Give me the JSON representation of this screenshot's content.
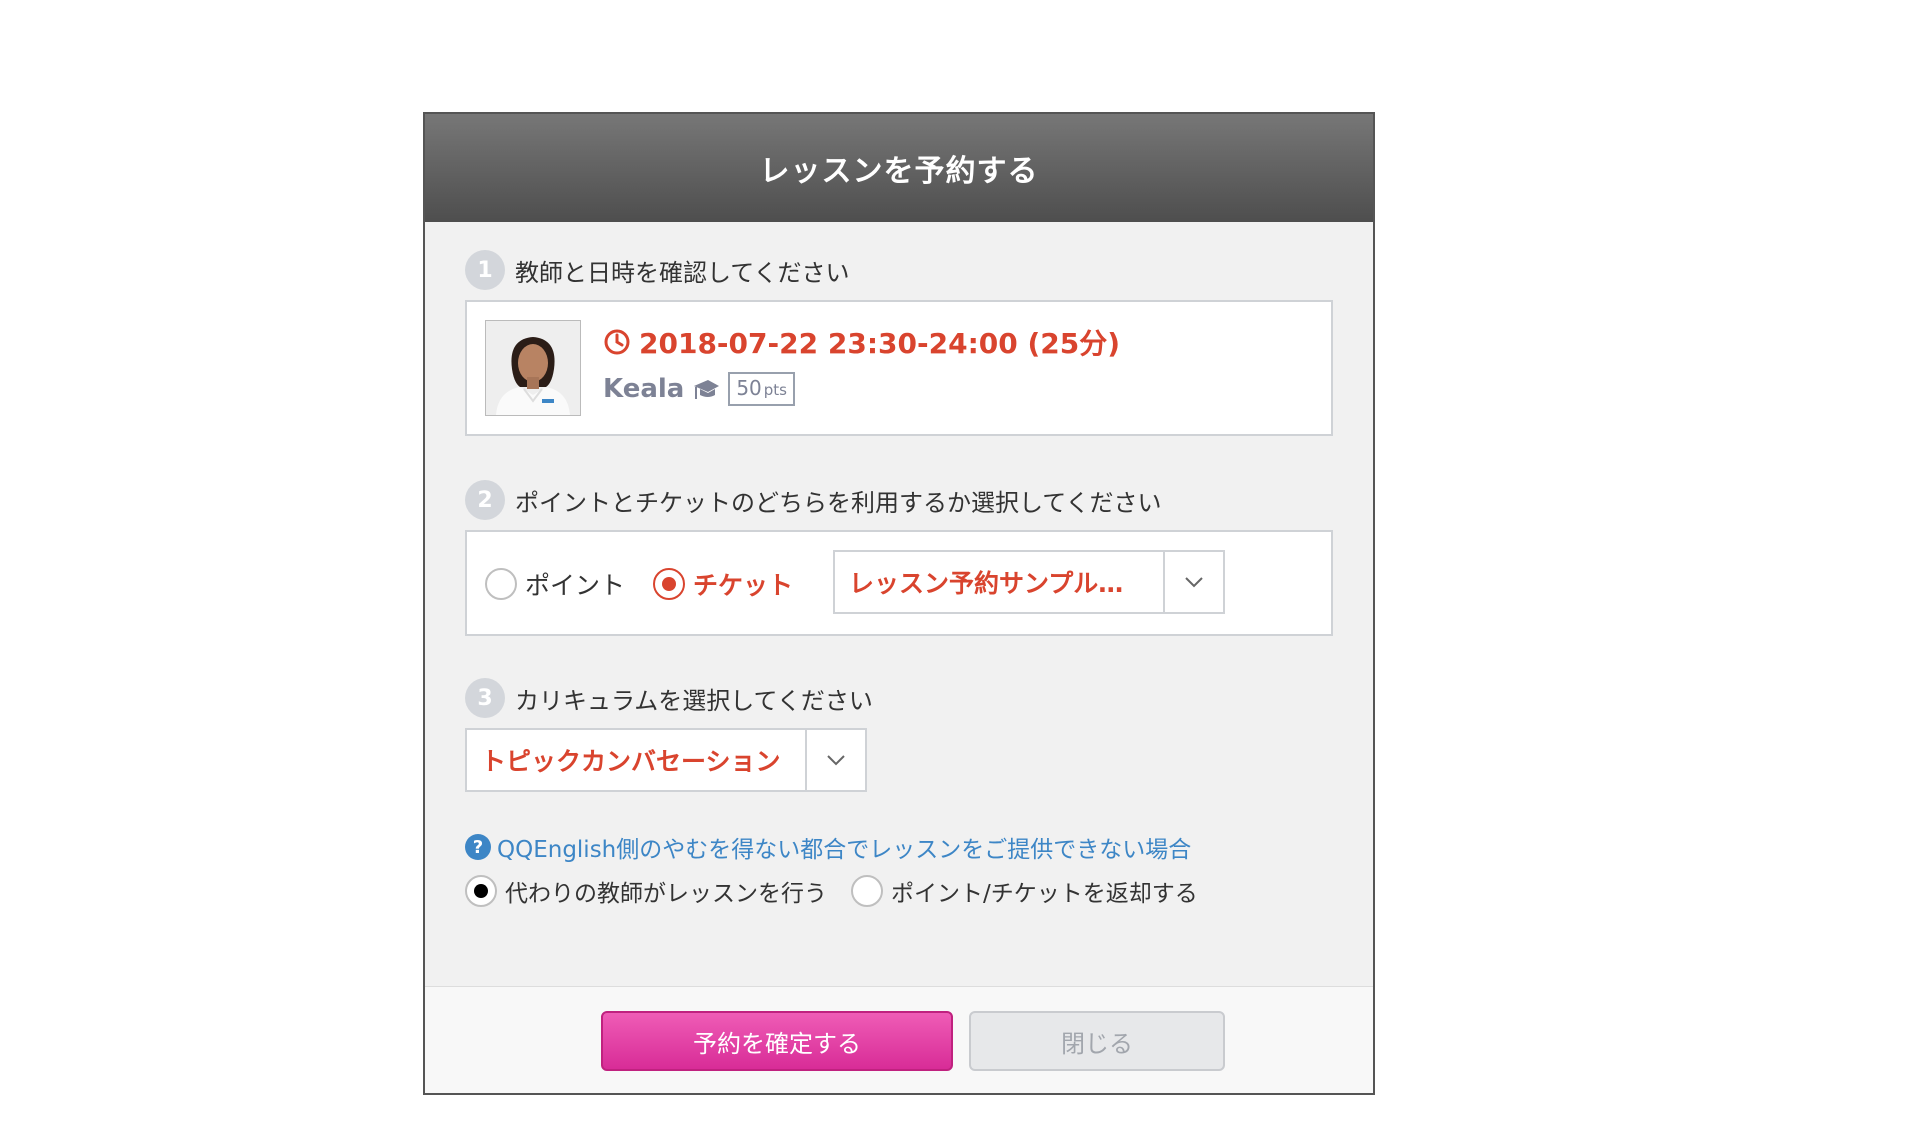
{
  "dialog": {
    "title": "レッスンを予約する"
  },
  "step1": {
    "number": "1",
    "title": "教師と日時を確認してください",
    "datetime": "2018-07-22 23:30-24:00 (25分)",
    "teacher_name": "Keala",
    "points_value": "50",
    "points_unit": "pts"
  },
  "step2": {
    "number": "2",
    "title": "ポイントとチケットのどちらを利用するか選択してください",
    "option_points": "ポイント",
    "option_ticket": "チケット",
    "selected": "チケット",
    "ticket_select_value": "レッスン予約サンプル…"
  },
  "step3": {
    "number": "3",
    "title": "カリキュラムを選択してください",
    "curriculum_value": "トピックカンバセーション"
  },
  "cancel_policy": {
    "question": "QQEnglish側のやむを得ない都合でレッスンをご提供できない場合",
    "option_substitute": "代わりの教師がレッスンを行う",
    "option_refund": "ポイント/チケットを返却する",
    "selected": "代わりの教師がレッスンを行う"
  },
  "footer": {
    "confirm_label": "予約を確定する",
    "close_label": "閉じる"
  },
  "colors": {
    "accent_red": "#d9442e",
    "brand_pink": "#e03ca3",
    "link_blue": "#3d86c6"
  },
  "icons": [
    "clock-icon",
    "graduation-cap-icon",
    "chevron-down-icon",
    "question-icon"
  ]
}
